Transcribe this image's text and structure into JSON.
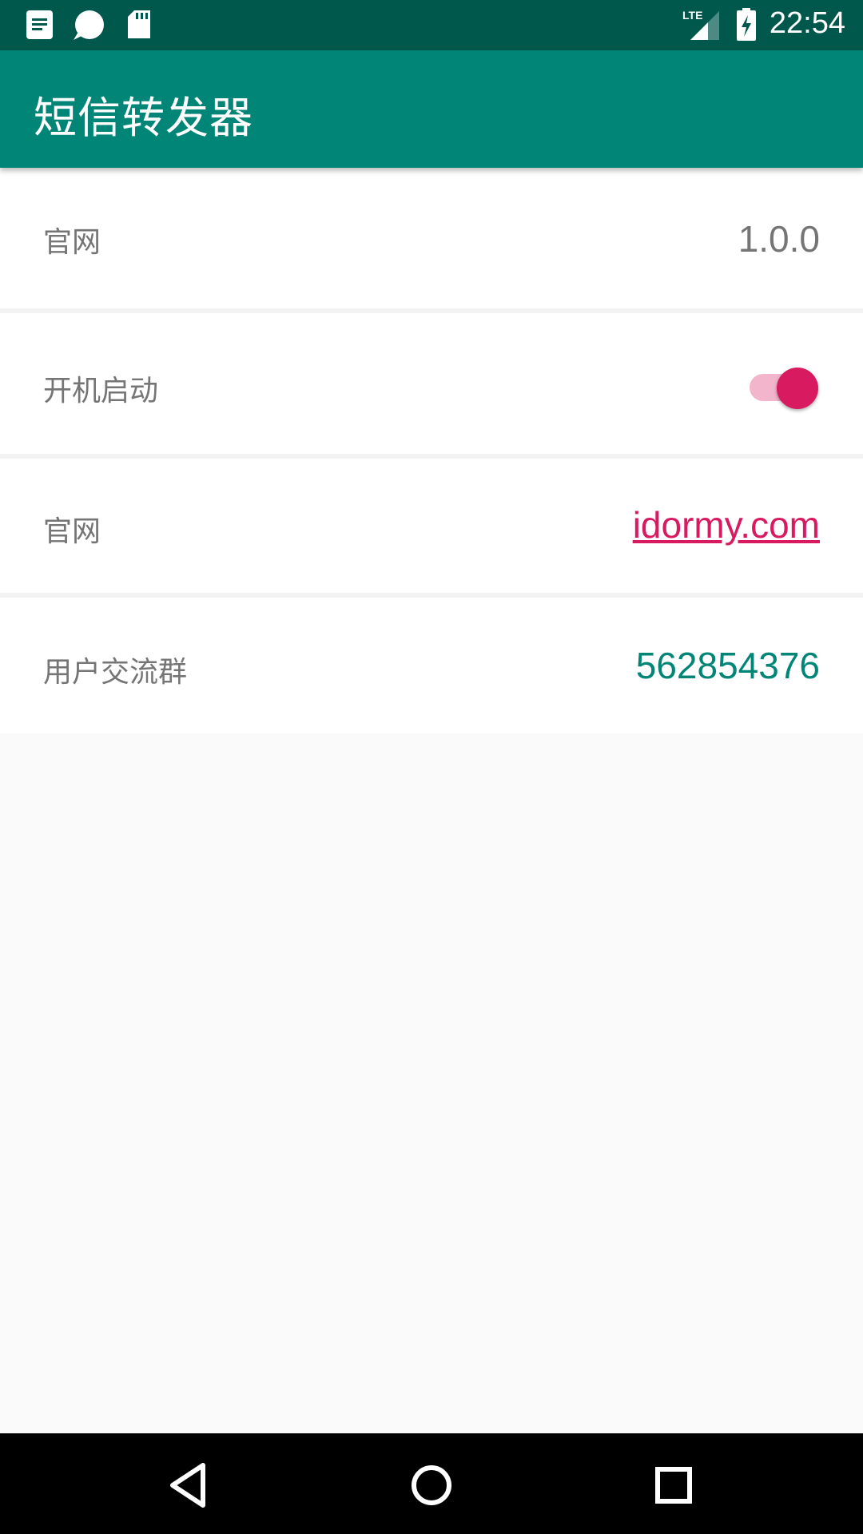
{
  "status_bar": {
    "time": "22:54",
    "network": "LTE",
    "left_icons": [
      "notes-icon",
      "chat-bubble-icon",
      "sd-card-icon"
    ],
    "right_icons": [
      "lte-signal-icon",
      "battery-charging-icon"
    ]
  },
  "app_bar": {
    "title": "短信转发器",
    "color": "#008577",
    "status_color": "#00574b"
  },
  "settings": {
    "version": {
      "label": "官网",
      "value": "1.0.0"
    },
    "autostart": {
      "label": "开机启动",
      "enabled": true,
      "accent": "#d81b60"
    },
    "website": {
      "label": "官网",
      "value": "idormy.com"
    },
    "group": {
      "label": "用户交流群",
      "value": "562854376"
    }
  },
  "nav_bar": {
    "buttons": [
      "back-icon",
      "home-icon",
      "recents-icon"
    ]
  }
}
